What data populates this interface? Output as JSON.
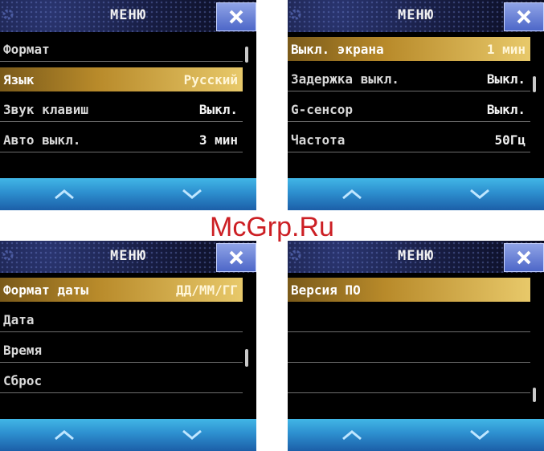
{
  "watermark": "McGrp.Ru",
  "screens": [
    {
      "title": "МЕНЮ",
      "rows": [
        {
          "label": "Формат",
          "value": "",
          "selected": false
        },
        {
          "label": "Язык",
          "value": "Русский",
          "selected": true
        },
        {
          "label": "Звук клавиш",
          "value": "Выкл.",
          "selected": false
        },
        {
          "label": "Авто выкл.",
          "value": "3 мин",
          "selected": false
        }
      ]
    },
    {
      "title": "МЕНЮ",
      "rows": [
        {
          "label": "Выкл. экрана",
          "value": "1 мин",
          "selected": true
        },
        {
          "label": "Задержка выкл.",
          "value": "Выкл.",
          "selected": false
        },
        {
          "label": "G-сенсор",
          "value": "Выкл.",
          "selected": false
        },
        {
          "label": "Частота",
          "value": "50Гц",
          "selected": false
        }
      ]
    },
    {
      "title": "МЕНЮ",
      "rows": [
        {
          "label": "Формат даты",
          "value": "ДД/ММ/ГГ",
          "selected": true
        },
        {
          "label": "Дата",
          "value": "",
          "selected": false
        },
        {
          "label": "Время",
          "value": "",
          "selected": false
        },
        {
          "label": "Сброс",
          "value": "",
          "selected": false
        }
      ]
    },
    {
      "title": "МЕНЮ",
      "rows": [
        {
          "label": "Версия ПО",
          "value": "",
          "selected": true
        },
        {
          "label": "",
          "value": "",
          "selected": false
        },
        {
          "label": "",
          "value": "",
          "selected": false
        },
        {
          "label": "",
          "value": "",
          "selected": false
        }
      ]
    }
  ],
  "icons": {
    "close": "close-icon",
    "up": "chevron-up-icon",
    "down": "chevron-down-icon",
    "gear": "gear-icon"
  },
  "colors": {
    "header_bg": "#151a3d",
    "close_bg": "#6f86d8",
    "selected_row": "#c89a35",
    "footer": "#2d8fcf",
    "watermark": "#cc1f24"
  }
}
